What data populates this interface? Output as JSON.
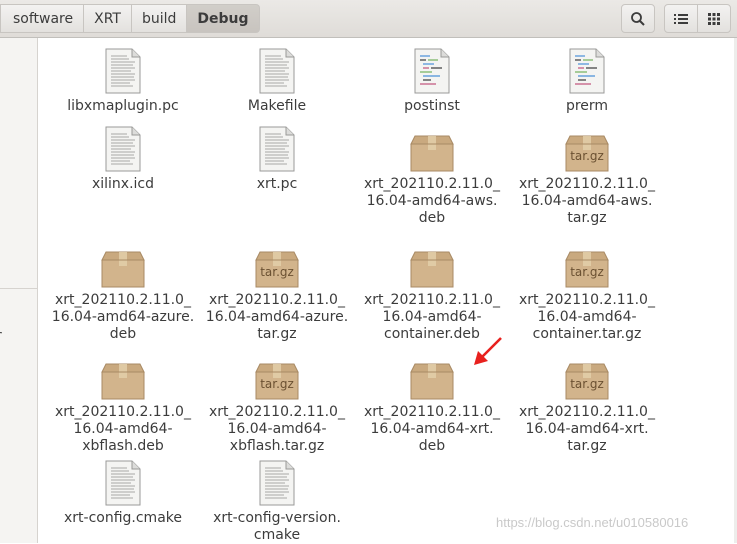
{
  "breadcrumbs": [
    "software",
    "XRT",
    "build",
    "Debug"
  ],
  "sidebar": {
    "fragment": "r"
  },
  "files": [
    {
      "name": "libxmaplugin.pc",
      "icon": "text-file"
    },
    {
      "name": "Makefile",
      "icon": "text-file"
    },
    {
      "name": "postinst",
      "icon": "script-file"
    },
    {
      "name": "prerm",
      "icon": "script-file"
    },
    {
      "name": "xilinx.icd",
      "icon": "text-file"
    },
    {
      "name": "xrt.pc",
      "icon": "text-file"
    },
    {
      "name": "xrt_202110.2.11.0_\n16.04-amd64-aws.\ndeb",
      "icon": "package"
    },
    {
      "name": "xrt_202110.2.11.0_\n16.04-amd64-aws.\ntar.gz",
      "icon": "archive"
    },
    {
      "name": "xrt_202110.2.11.0_\n16.04-amd64-azure.\ndeb",
      "icon": "package"
    },
    {
      "name": "xrt_202110.2.11.0_\n16.04-amd64-azure.\ntar.gz",
      "icon": "archive"
    },
    {
      "name": "xrt_202110.2.11.0_\n16.04-amd64-\ncontainer.deb",
      "icon": "package"
    },
    {
      "name": "xrt_202110.2.11.0_\n16.04-amd64-\ncontainer.tar.gz",
      "icon": "archive"
    },
    {
      "name": "xrt_202110.2.11.0_\n16.04-amd64-\nxbflash.deb",
      "icon": "package"
    },
    {
      "name": "xrt_202110.2.11.0_\n16.04-amd64-\nxbflash.tar.gz",
      "icon": "archive"
    },
    {
      "name": "xrt_202110.2.11.0_\n16.04-amd64-xrt.\ndeb",
      "icon": "package"
    },
    {
      "name": "xrt_202110.2.11.0_\n16.04-amd64-xrt.\ntar.gz",
      "icon": "archive"
    },
    {
      "name": "xrt-config.cmake",
      "icon": "text-file"
    },
    {
      "name": "xrt-config-version.\ncmake",
      "icon": "text-file"
    }
  ],
  "archive_badge": "tar.gz",
  "watermark": "https://blog.csdn.net/u010580016",
  "colors": {
    "annotation_arrow": "#e8211e",
    "box": "#d2b48c",
    "box_dark": "#b89670"
  }
}
